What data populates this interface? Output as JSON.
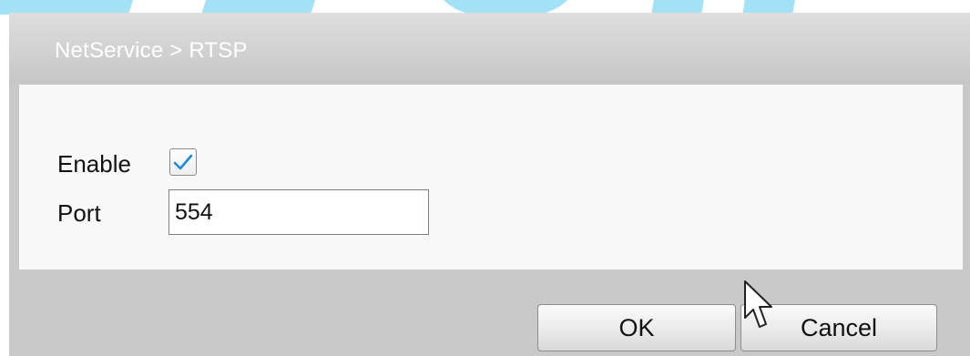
{
  "dialog": {
    "title": "NetService > RTSP"
  },
  "form": {
    "enable_label": "Enable",
    "enable_checked": true,
    "port_label": "Port",
    "port_value": "554"
  },
  "buttons": {
    "ok_label": "OK",
    "cancel_label": "Cancel"
  },
  "colors": {
    "checkmark": "#1f8be0",
    "watermark": "#58c8f0"
  },
  "icons": {
    "checkbox_mark": "check-icon",
    "pointer": "mouse-cursor-icon"
  }
}
